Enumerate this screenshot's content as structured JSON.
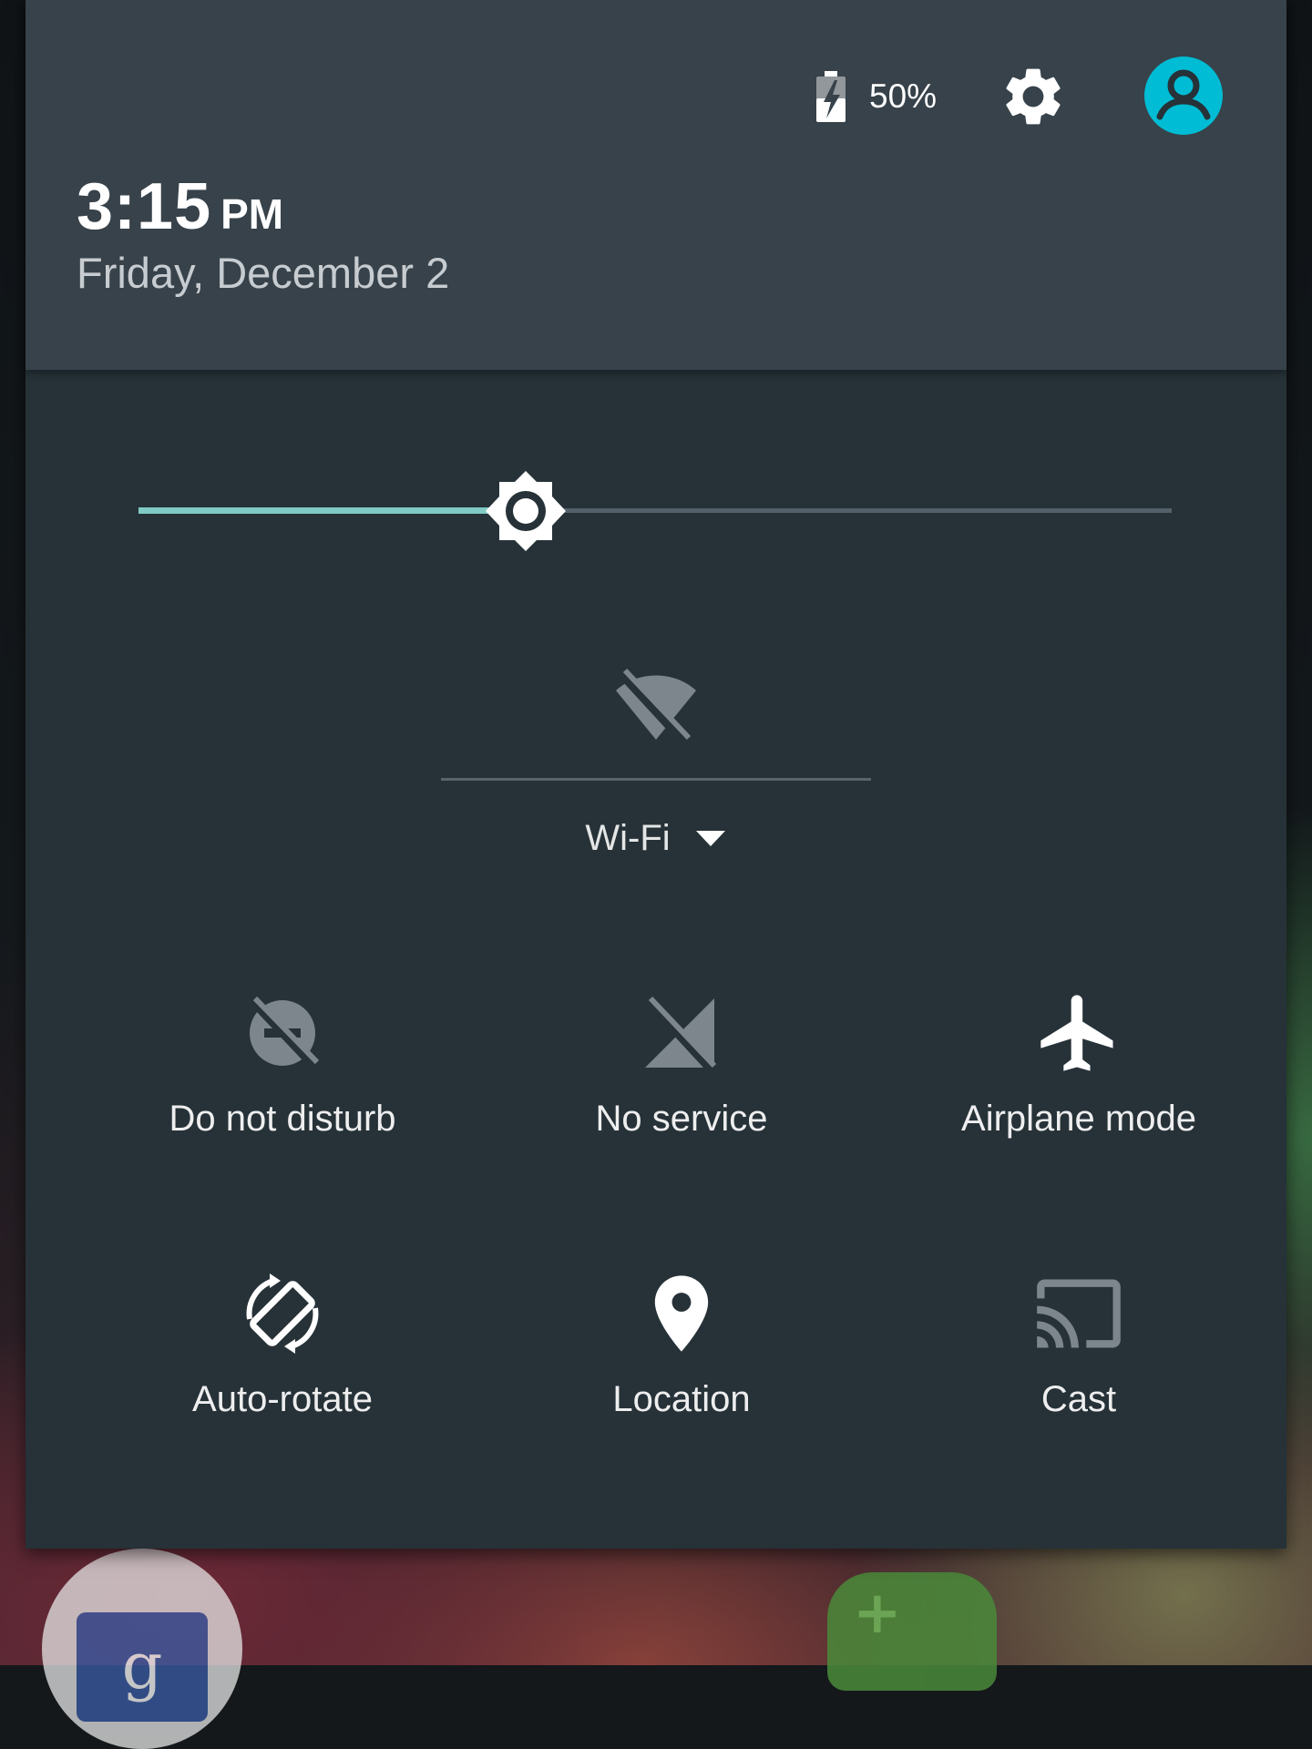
{
  "status": {
    "battery_percent": "50%",
    "battery_icon": "battery-charging-icon"
  },
  "header": {
    "time": "3:15",
    "ampm": "PM",
    "date": "Friday, December 2",
    "settings_icon": "gear-icon",
    "avatar_icon": "account-circle-icon"
  },
  "brightness": {
    "level": 0.375,
    "icon": "brightness-icon",
    "active_color": "#80cbc4"
  },
  "wifi": {
    "label": "Wi-Fi",
    "icon": "wifi-off-icon",
    "dropdown_icon": "caret-down-icon"
  },
  "tiles": [
    {
      "label": "Do not disturb",
      "icon": "do-not-disturb-off-icon"
    },
    {
      "label": "No service",
      "icon": "no-signal-icon"
    },
    {
      "label": "Airplane mode",
      "icon": "airplane-icon"
    },
    {
      "label": "Auto-rotate",
      "icon": "auto-rotate-icon"
    },
    {
      "label": "Location",
      "icon": "location-pin-icon"
    },
    {
      "label": "Cast",
      "icon": "cast-icon"
    }
  ],
  "colors": {
    "header_bg": "#37424a",
    "panel_bg": "#263238",
    "avatar_bg": "#00bcd4"
  }
}
